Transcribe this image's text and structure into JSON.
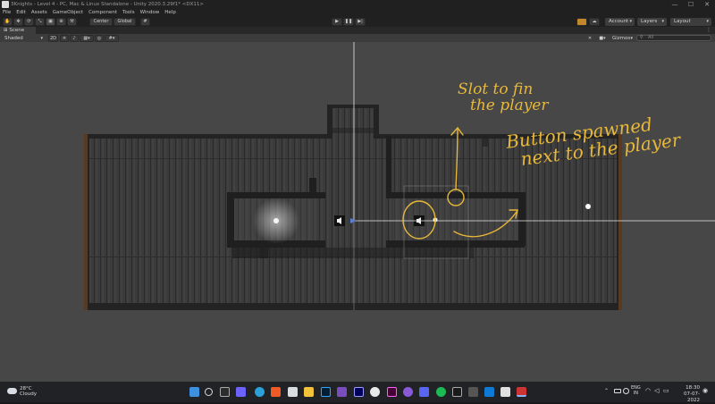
{
  "window": {
    "title": "3Knights - Level 4 - PC, Mac & Linux Standalone - Unity 2020.3.29f1* <DX11>",
    "controls": [
      "—",
      "☐",
      "✕"
    ]
  },
  "menu": [
    "File",
    "Edit",
    "Assets",
    "GameObject",
    "Component",
    "Tools",
    "Window",
    "Help"
  ],
  "toolbar": {
    "pivot_mode": "Center",
    "pivot_space": "Global",
    "play_icons": [
      "play-icon",
      "pause-icon",
      "step-icon"
    ],
    "account": "Account",
    "layers": "Layers",
    "layout": "Layout"
  },
  "scene": {
    "tab_label": "Scene",
    "shading_mode": "Shaded",
    "mode_2d": "2D",
    "gizmos": "Gizmos",
    "search_placeholder": "All"
  },
  "annotations": {
    "slot": [
      "Slot to fin",
      "the player"
    ],
    "button": [
      "Button spawned",
      "next to the player"
    ],
    "color": "#e8b83a"
  },
  "taskbar": {
    "weather_temp": "28°C",
    "weather_desc": "Cloudy",
    "lang": "ENG",
    "region": "IN",
    "time": "18:30",
    "date": "07-07-2022"
  }
}
